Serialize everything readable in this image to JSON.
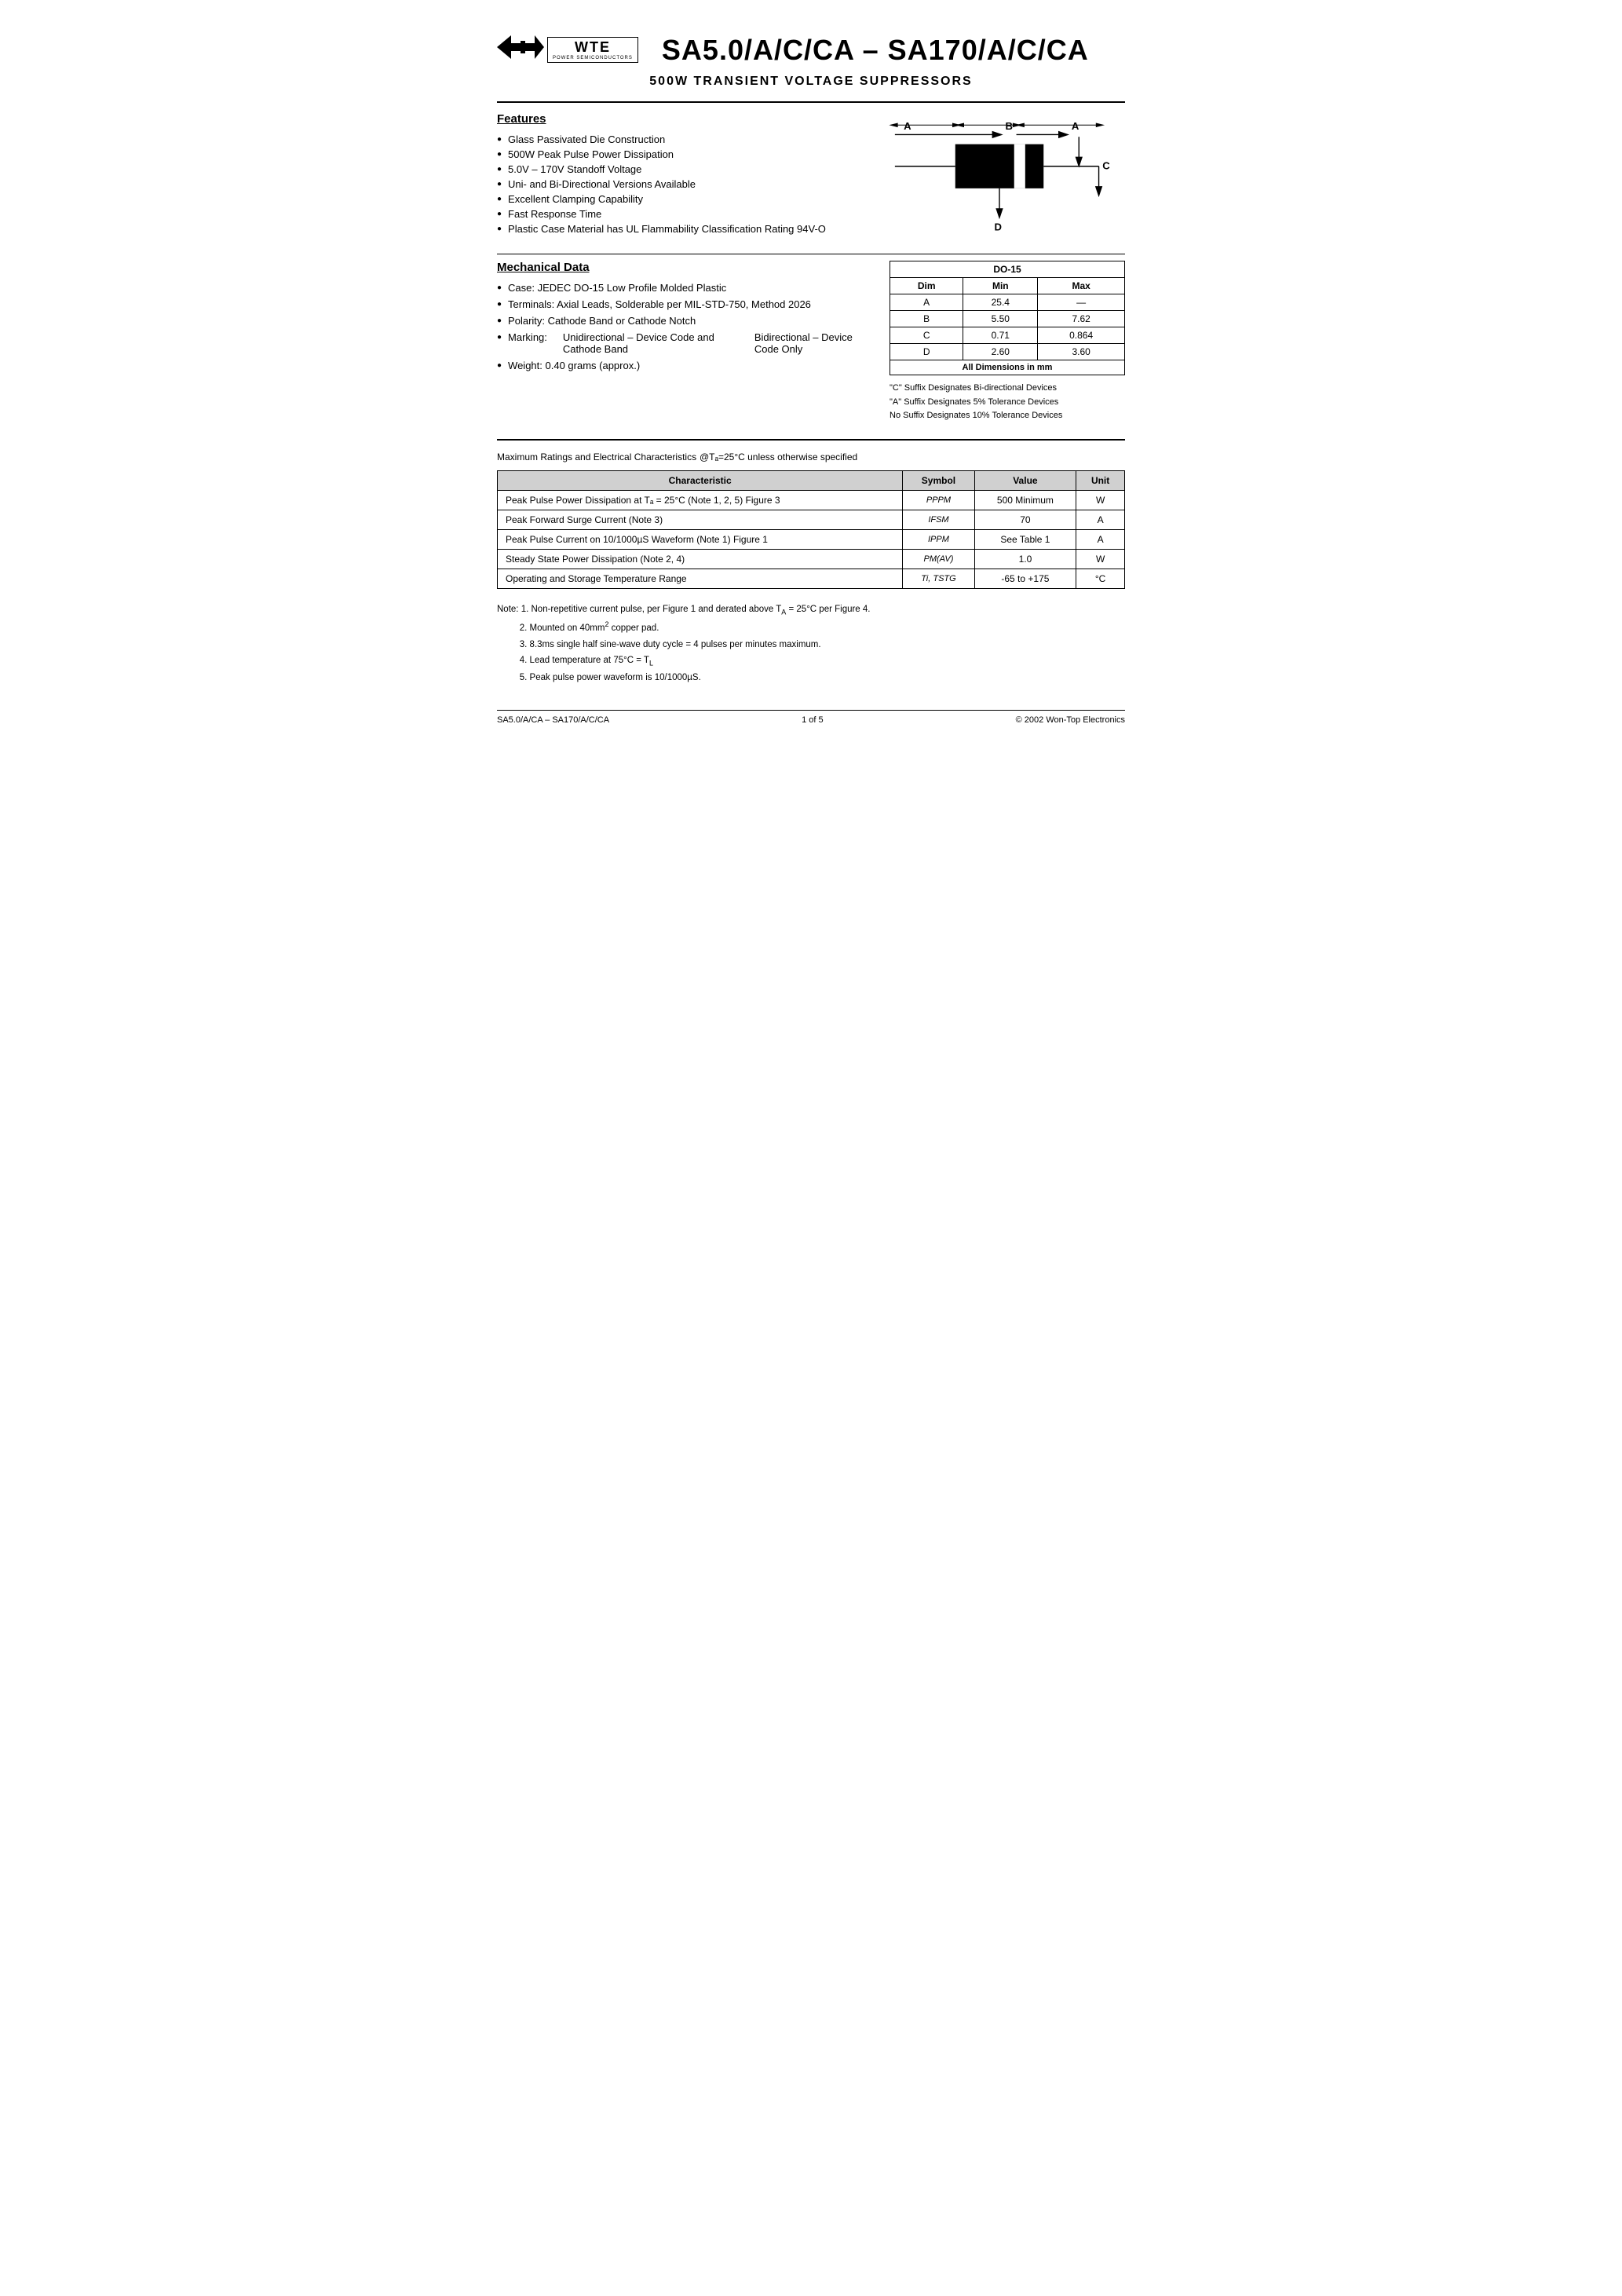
{
  "header": {
    "logo_arrow": "◄ ►",
    "logo_text": "WTE",
    "logo_sub": "POWER SEMICONDUCTORS",
    "main_title": "SA5.0/A/C/CA – SA170/A/C/CA",
    "subtitle": "500W TRANSIENT VOLTAGE SUPPRESSORS"
  },
  "features": {
    "title": "Features",
    "items": [
      "Glass Passivated Die Construction",
      "500W Peak Pulse Power Dissipation",
      "5.0V – 170V Standoff Voltage",
      "Uni- and Bi-Directional Versions Available",
      "Excellent Clamping Capability",
      "Fast Response Time",
      "Plastic Case Material has UL Flammability Classification Rating 94V-O"
    ]
  },
  "mechanical": {
    "title": "Mechanical Data",
    "items": [
      "Case: JEDEC DO-15 Low Profile Molded Plastic",
      "Terminals: Axial Leads, Solderable per MIL-STD-750, Method 2026",
      "Polarity: Cathode Band or Cathode Notch",
      "Marking:",
      "Unidirectional – Device Code and Cathode Band",
      "Bidirectional – Device Code Only",
      "Weight: 0.40 grams (approx.)"
    ]
  },
  "dimension_table": {
    "package": "DO-15",
    "headers": [
      "Dim",
      "Min",
      "Max"
    ],
    "rows": [
      {
        "dim": "A",
        "min": "25.4",
        "max": "—"
      },
      {
        "dim": "B",
        "min": "5.50",
        "max": "7.62"
      },
      {
        "dim": "C",
        "min": "0.71",
        "max": "0.864"
      },
      {
        "dim": "D",
        "min": "2.60",
        "max": "3.60"
      }
    ],
    "footer": "All Dimensions in mm"
  },
  "suffix_notes": [
    "\"C\" Suffix Designates Bi-directional Devices",
    "\"A\" Suffix Designates 5% Tolerance Devices",
    "No Suffix Designates 10% Tolerance Devices"
  ],
  "max_ratings": {
    "title": "Maximum Ratings and Electrical Characteristics",
    "condition": "@Tₐ=25°C unless otherwise specified",
    "headers": [
      "Characteristic",
      "Symbol",
      "Value",
      "Unit"
    ],
    "rows": [
      {
        "characteristic": "Peak Pulse Power Dissipation at Tₐ = 25°C (Note 1, 2, 5) Figure 3",
        "symbol": "PPPM",
        "value": "500 Minimum",
        "unit": "W"
      },
      {
        "characteristic": "Peak Forward Surge Current (Note 3)",
        "symbol": "IFSM",
        "value": "70",
        "unit": "A"
      },
      {
        "characteristic": "Peak Pulse Current on 10/1000µS Waveform (Note 1) Figure 1",
        "symbol": "IPPM",
        "value": "See Table 1",
        "unit": "A"
      },
      {
        "characteristic": "Steady State Power Dissipation (Note 2, 4)",
        "symbol": "PM(AV)",
        "value": "1.0",
        "unit": "W"
      },
      {
        "characteristic": "Operating and Storage Temperature Range",
        "symbol": "Ti, TSTG",
        "value": "-65 to +175",
        "unit": "°C"
      }
    ]
  },
  "notes": {
    "title": "Note:",
    "items": [
      "1. Non-repetitive current pulse, per Figure 1 and derated above Tₐ = 25°C per Figure 4.",
      "2. Mounted on 40mm² copper pad.",
      "3. 8.3ms single half sine-wave duty cycle = 4 pulses per minutes maximum.",
      "4. Lead temperature at 75°C = Tₗ",
      "5. Peak pulse power waveform is 10/1000µS."
    ]
  },
  "footer": {
    "left": "SA5.0/A/CA – SA170/A/C/CA",
    "center": "1 of 5",
    "right": "© 2002 Won-Top Electronics"
  }
}
